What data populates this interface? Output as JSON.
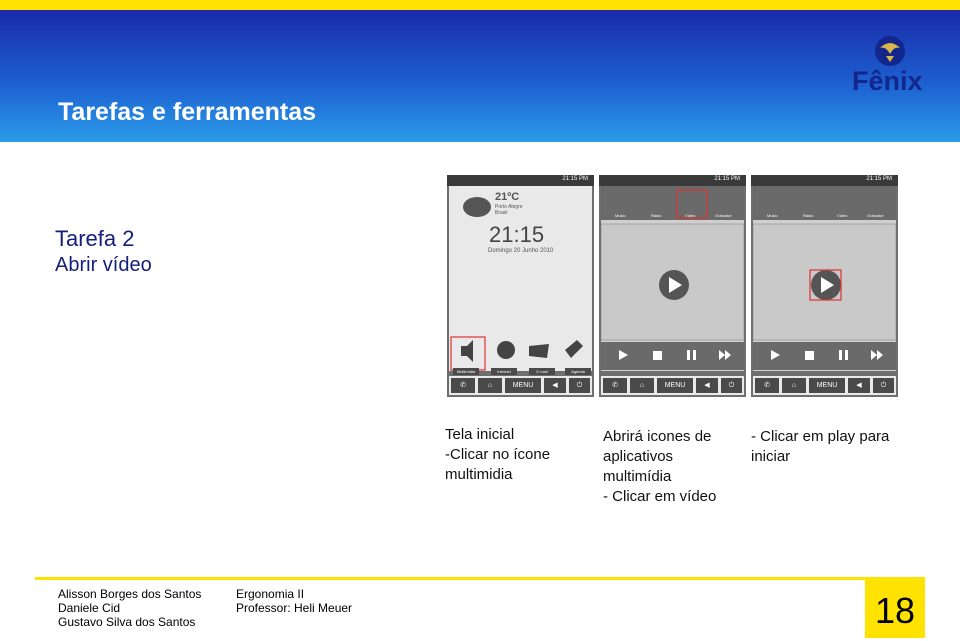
{
  "header": {
    "title": "Tarefas e ferramentas",
    "logo_text": "Fênix"
  },
  "task": {
    "title": "Tarefa 2",
    "subtitle": "Abrir vídeo"
  },
  "phones": {
    "time": "21:15 PM",
    "home": {
      "temperature": "21ºC",
      "city": "Porto Alegre",
      "country": "Brasil",
      "clock": "21:15",
      "date": "Domingo 20 Junho 2010",
      "apps": [
        "Multimídia",
        "Internet",
        "E-mail",
        "Agenda"
      ]
    },
    "media_apps": [
      "Music",
      "Rádio",
      "Vídeo",
      "Gravador"
    ],
    "menu_label": "MENU"
  },
  "captions": {
    "c1": [
      "Tela inicial",
      "-Clicar no ícone",
      "multimidia"
    ],
    "c2": [
      "Abrirá icones de",
      "aplicativos",
      "multimídia",
      "- Clicar em vídeo"
    ],
    "c3": [
      "- Clicar em play para",
      "iniciar"
    ]
  },
  "footer": {
    "authors": [
      "Alisson Borges dos Santos",
      "Daniele Cid",
      "Gustavo Silva dos Santos"
    ],
    "course": [
      "Ergonomia II",
      "Professor: Heli Meuer"
    ],
    "page": "18"
  }
}
